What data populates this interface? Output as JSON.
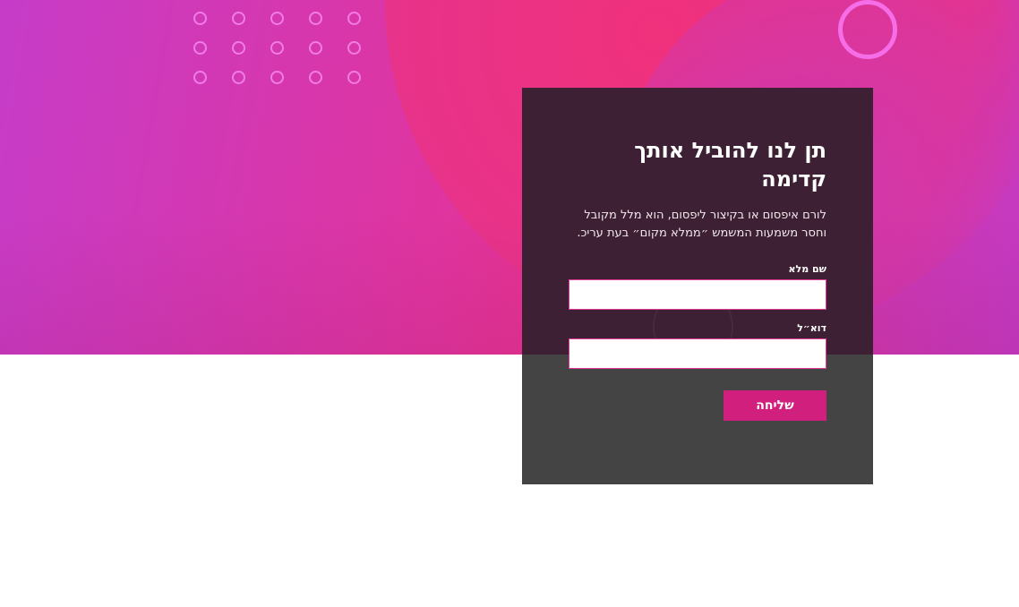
{
  "form": {
    "title": "תן לנו להוביל אותך קדימה",
    "description": "לורם איפסום או בקיצור ליפסום, הוא מלל מקובל וחסר משמעות המשמש ״ממלא מקום״ בעת עריכ.",
    "name_label": "שם מלא",
    "name_value": "",
    "email_label": "דוא״ל",
    "email_value": "",
    "submit_label": "שליחה"
  },
  "colors": {
    "accent": "#d01f7c",
    "panel_top": "#3d2033",
    "panel_bottom": "#444444",
    "decor_dot": "#f07ce6",
    "decor_ring": "#f56ee8"
  },
  "icons": [
    "decorative-circle-grid",
    "decorative-ring"
  ]
}
